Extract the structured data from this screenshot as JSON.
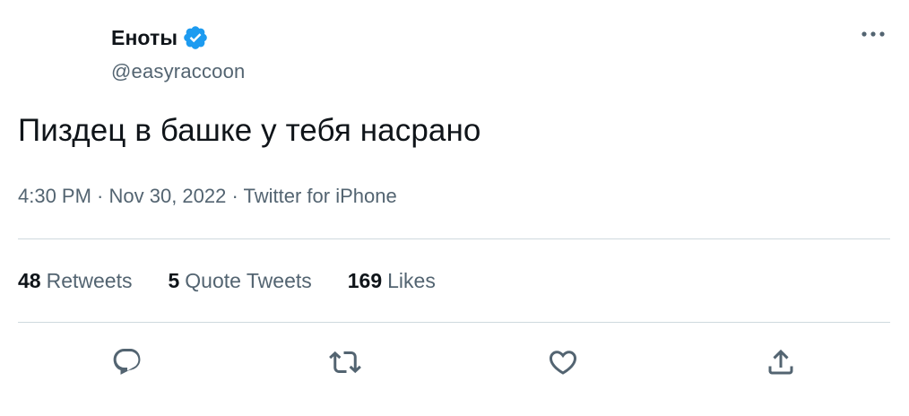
{
  "author": {
    "display_name": "Еноты",
    "handle": "@easyraccoon",
    "verified": true
  },
  "tweet": {
    "text": "Пиздец в башке у тебя насрано",
    "time": "4:30 PM",
    "date": "Nov 30, 2022",
    "source": "Twitter for iPhone",
    "separator": " · "
  },
  "stats": [
    {
      "count": "48",
      "label": "Retweets"
    },
    {
      "count": "5",
      "label": "Quote Tweets"
    },
    {
      "count": "169",
      "label": "Likes"
    }
  ],
  "icons": {
    "more": "more-icon",
    "verified": "verified-badge-icon",
    "reply": "reply-icon",
    "retweet": "retweet-icon",
    "like": "like-icon",
    "share": "share-icon"
  },
  "colors": {
    "text": "#0f1419",
    "secondary": "#536471",
    "divider": "#cfd9de",
    "verified": "#1d9bf0"
  }
}
